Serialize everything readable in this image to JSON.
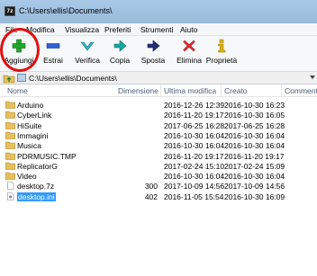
{
  "window": {
    "title": "C:\\Users\\ellis\\Documents\\"
  },
  "menu": [
    "File",
    "Modifica",
    "Visualizza",
    "Preferiti",
    "Strumenti",
    "Aiuto"
  ],
  "toolbar": [
    {
      "label": "Aggiungi",
      "icon": "plus-icon"
    },
    {
      "label": "Estrai",
      "icon": "minus-icon"
    },
    {
      "label": "Verifica",
      "icon": "check-icon"
    },
    {
      "label": "Copia",
      "icon": "copy-arrow-icon"
    },
    {
      "label": "Sposta",
      "icon": "move-arrow-icon"
    },
    {
      "label": "Elimina",
      "icon": "delete-x-icon"
    },
    {
      "label": "Proprietà",
      "icon": "info-icon"
    }
  ],
  "address": {
    "path": "C:\\Users\\ellis\\Documents\\"
  },
  "columns": {
    "name": "Nome",
    "size": "Dimensione",
    "modified": "Ultima modifica",
    "created": "Creato",
    "comment": "Commenti"
  },
  "files": [
    {
      "name": "Arduino",
      "size": "",
      "modified": "2016-12-26 12:39",
      "created": "2016-10-30 16:23",
      "type": "folder"
    },
    {
      "name": "CyberLink",
      "size": "",
      "modified": "2016-11-20 19:17",
      "created": "2016-10-30 16:05",
      "type": "folder"
    },
    {
      "name": "HiSuite",
      "size": "",
      "modified": "2017-06-25 16:28",
      "created": "2017-06-25 16:28",
      "type": "folder"
    },
    {
      "name": "Immagini",
      "size": "",
      "modified": "2016-10-30 16:04",
      "created": "2016-10-30 16:04",
      "type": "folder"
    },
    {
      "name": "Musica",
      "size": "",
      "modified": "2016-10-30 16:04",
      "created": "2016-10-30 16:04",
      "type": "folder"
    },
    {
      "name": "PDRMUSIC.TMP",
      "size": "",
      "modified": "2016-11-20 19:17",
      "created": "2016-11-20 19:17",
      "type": "folder"
    },
    {
      "name": "ReplicatorG",
      "size": "",
      "modified": "2017-02-24 15:10",
      "created": "2017-02-24 15:09",
      "type": "folder"
    },
    {
      "name": "Video",
      "size": "",
      "modified": "2016-10-30 16:04",
      "created": "2016-10-30 16:04",
      "type": "folder"
    },
    {
      "name": "desktop.7z",
      "size": "300",
      "modified": "2017-10-09 14:56",
      "created": "2017-10-09 14:56",
      "type": "file"
    },
    {
      "name": "desktop.ini",
      "size": "402",
      "modified": "2016-11-05 15:54",
      "created": "2016-10-30 16:09",
      "type": "ini"
    }
  ],
  "selected_index": 9,
  "colors": {
    "folder": "#e8c05a",
    "selection": "#3399ff",
    "annotation_circle": "#e01010"
  }
}
